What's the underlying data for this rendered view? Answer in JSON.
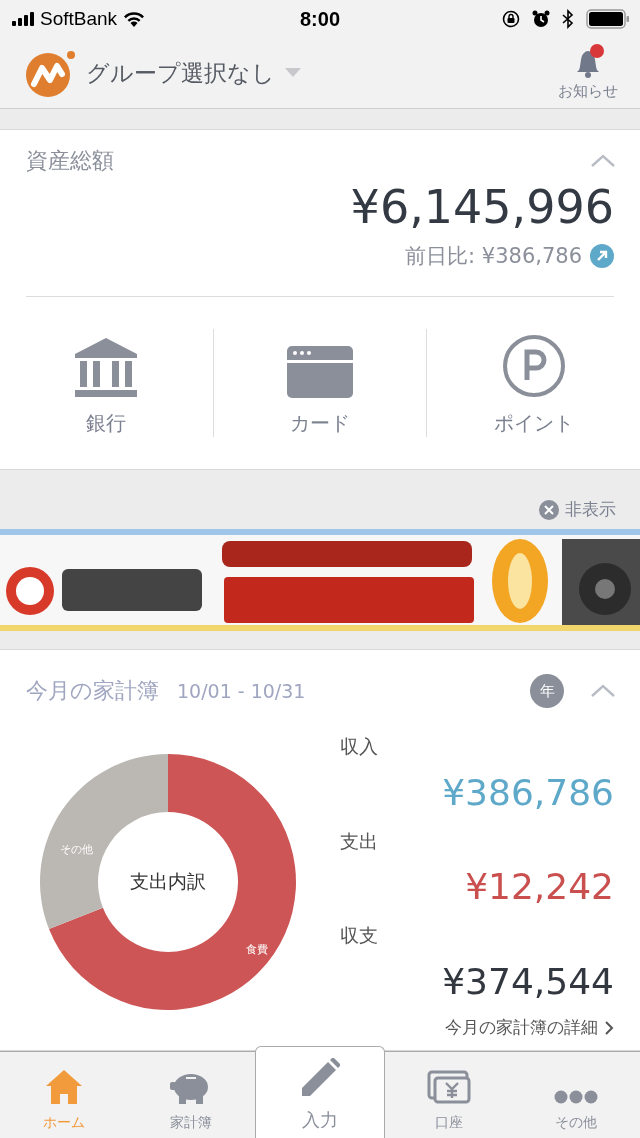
{
  "status_bar": {
    "carrier": "SoftBank",
    "time": "8:00"
  },
  "header": {
    "group": "グループ選択なし",
    "notifications": {
      "label": "お知らせ",
      "unread": true
    }
  },
  "assets": {
    "title": "資産総額",
    "expanded": true,
    "total": "¥6,145,996",
    "change_label": "前日比: ¥386,786",
    "rising": true,
    "categories": [
      {
        "kind": "bank",
        "label": "銀行"
      },
      {
        "kind": "card",
        "label": "カード"
      },
      {
        "kind": "point",
        "label": "ポイント"
      }
    ]
  },
  "ad": {
    "hide_label": "非表示",
    "kind": "picture"
  },
  "budget": {
    "title": "今月の家計簿",
    "period": "10/01 - 10/31",
    "year_badge": "年",
    "expanded": true,
    "breakdown": {
      "center_label": "支出内訳",
      "slices": [
        {
          "label": "食費",
          "color": "#cd5555"
        },
        {
          "label": "その他",
          "color": "#bbb8b3"
        }
      ]
    },
    "rows": [
      {
        "kind": "income",
        "label": "収入",
        "amount": "¥386,786"
      },
      {
        "kind": "expense",
        "label": "支出",
        "amount": "¥12,242"
      },
      {
        "kind": "balance",
        "label": "収支",
        "amount": "¥374,544"
      }
    ],
    "detail_link": "今月の家計簿の詳細"
  },
  "tabs": [
    {
      "kind": "home",
      "label": "ホーム",
      "selected": true
    },
    {
      "kind": "budget",
      "label": "家計簿",
      "selected": false
    },
    {
      "kind": "input",
      "label": "入力",
      "selected": false
    },
    {
      "kind": "accounts",
      "label": "口座",
      "selected": false
    },
    {
      "kind": "more",
      "label": "その他",
      "selected": false
    }
  ]
}
